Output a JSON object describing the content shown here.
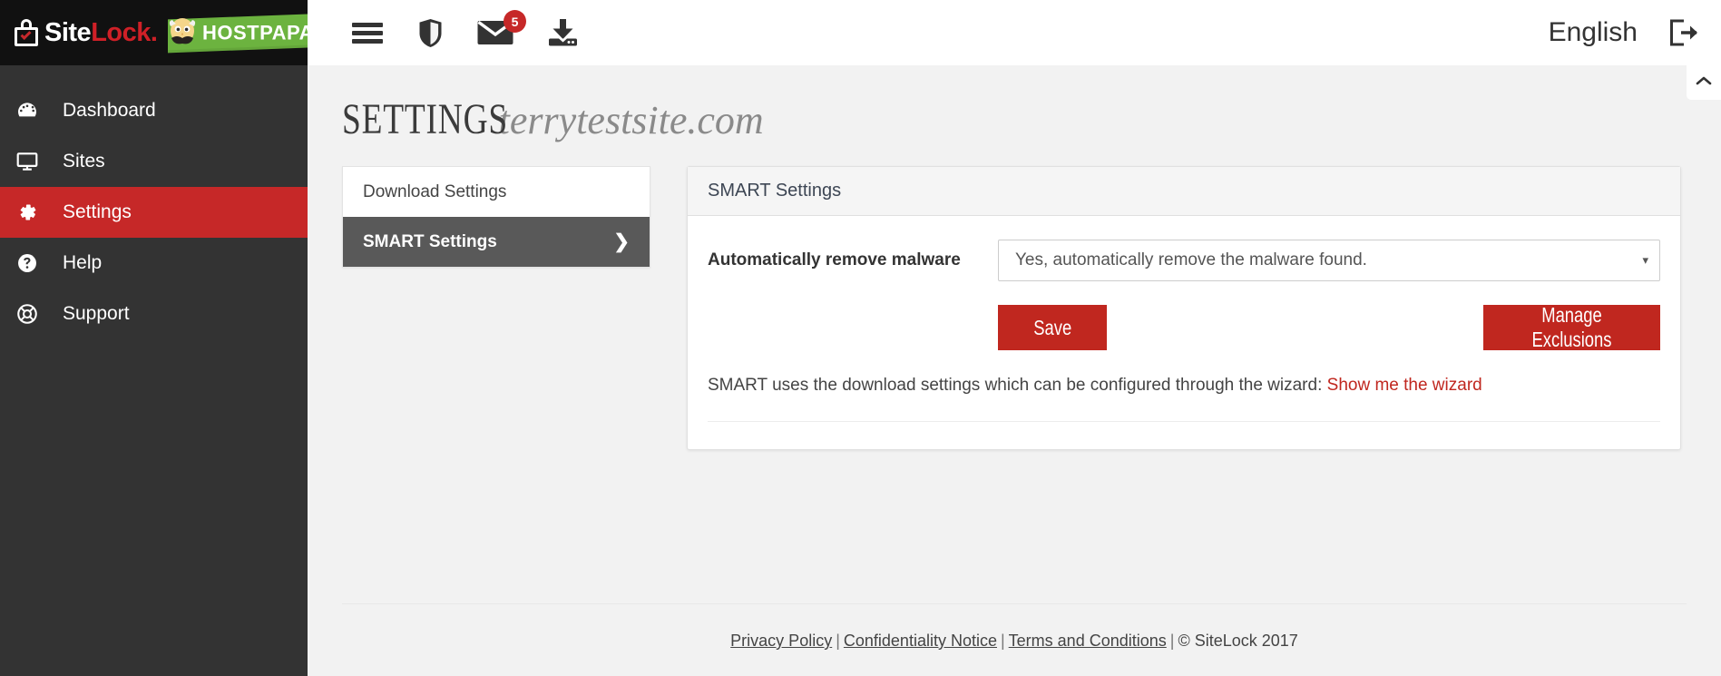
{
  "brand": {
    "name_part1": "Site",
    "name_part2": "Lock",
    "name_dot": ".",
    "partner": "HOSTPAPA",
    "lock_icon": "lock-check-icon",
    "papa_icon": "hostpapa-mascot-icon"
  },
  "sidebar": {
    "items": [
      {
        "label": "Dashboard",
        "icon": "tachometer-icon",
        "active": false
      },
      {
        "label": "Sites",
        "icon": "desktop-icon",
        "active": false
      },
      {
        "label": "Settings",
        "icon": "gear-icon",
        "active": true
      },
      {
        "label": "Help",
        "icon": "question-circle-icon",
        "active": false
      },
      {
        "label": "Support",
        "icon": "life-ring-icon",
        "active": false
      }
    ],
    "active_color": "#c62828",
    "background": "#333333"
  },
  "topbar": {
    "menu_icon": "hamburger-menu-icon",
    "shield_icon": "shield-icon",
    "mail_icon": "envelope-icon",
    "mail_badge": "5",
    "download_icon": "download-inbox-icon",
    "language": "English",
    "logout_icon": "sign-out-icon",
    "badge_color": "#c62828"
  },
  "page": {
    "title": "SETTINGS",
    "site": "terrytestsite.com",
    "scroll_top_icon": "chevron-up-icon"
  },
  "settings_menu": {
    "items": [
      {
        "label": "Download Settings",
        "active": false,
        "chevron": ""
      },
      {
        "label": "SMART Settings",
        "active": true,
        "chevron": "❯"
      }
    ]
  },
  "panel": {
    "header": "SMART Settings",
    "field_label": "Automatically remove malware",
    "select_value": "Yes, automatically remove the malware found.",
    "select_caret": "▾",
    "select_options": [
      "Yes, automatically remove the malware found."
    ],
    "save_label": "Save",
    "manage_label": "Manage Exclusions",
    "button_color": "#c0271f",
    "note_text": "SMART uses the download settings which can be configured through the wizard: ",
    "note_link": "Show me the wizard"
  },
  "footer": {
    "privacy": "Privacy Policy",
    "confidentiality": "Confidentiality Notice",
    "terms": "Terms and Conditions",
    "copyright": "© SiteLock 2017",
    "separator": "|"
  }
}
